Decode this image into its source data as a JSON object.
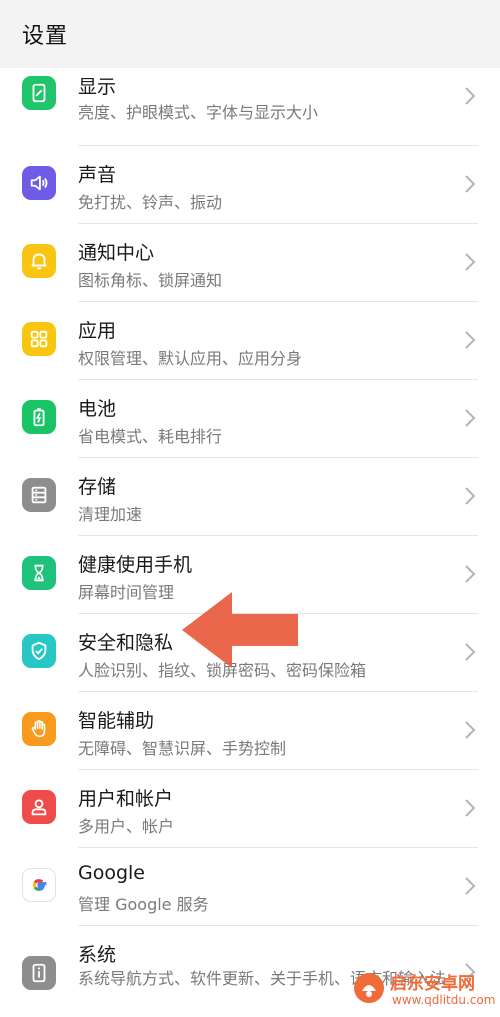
{
  "header": {
    "title": "设置"
  },
  "items": [
    {
      "title": "显示",
      "subtitle": "亮度、护眼模式、字体与显示大小",
      "icon": "display-icon",
      "color": "#1fc46b"
    },
    {
      "title": "声音",
      "subtitle": "免打扰、铃声、振动",
      "icon": "sound-icon",
      "color": "#6e5ce6"
    },
    {
      "title": "通知中心",
      "subtitle": "图标角标、锁屏通知",
      "icon": "bell-icon",
      "color": "#f7c512"
    },
    {
      "title": "应用",
      "subtitle": "权限管理、默认应用、应用分身",
      "icon": "apps-icon",
      "color": "#f9c60f"
    },
    {
      "title": "电池",
      "subtitle": "省电模式、耗电排行",
      "icon": "battery-icon",
      "color": "#19c464"
    },
    {
      "title": "存储",
      "subtitle": "清理加速",
      "icon": "storage-icon",
      "color": "#8d8d8d"
    },
    {
      "title": "健康使用手机",
      "subtitle": "屏幕时间管理",
      "icon": "hourglass-icon",
      "color": "#1ec27a"
    },
    {
      "title": "安全和隐私",
      "subtitle": "人脸识别、指纹、锁屏密码、密码保险箱",
      "icon": "shield-icon",
      "color": "#27c8c4"
    },
    {
      "title": "智能辅助",
      "subtitle": "无障碍、智慧识屏、手势控制",
      "icon": "hand-icon",
      "color": "#f79a1d"
    },
    {
      "title": "用户和帐户",
      "subtitle": "多用户、帐户",
      "icon": "user-icon",
      "color": "#ee4c4c"
    },
    {
      "title": "Google",
      "subtitle": "管理 Google 服务",
      "icon": "google-icon",
      "color": "#ffffff"
    },
    {
      "title": "系统",
      "subtitle": "系统导航方式、软件更新、关于手机、语言和输入法",
      "icon": "phone-info-icon",
      "color": "#8d8d8d"
    }
  ],
  "watermark": {
    "name": "启东安卓网",
    "url": "www.qdlitdu.com"
  },
  "colors": {
    "arrow": "#e85a3c",
    "chevron": "#b5b5b5",
    "header_bg": "#f3f3f3"
  }
}
